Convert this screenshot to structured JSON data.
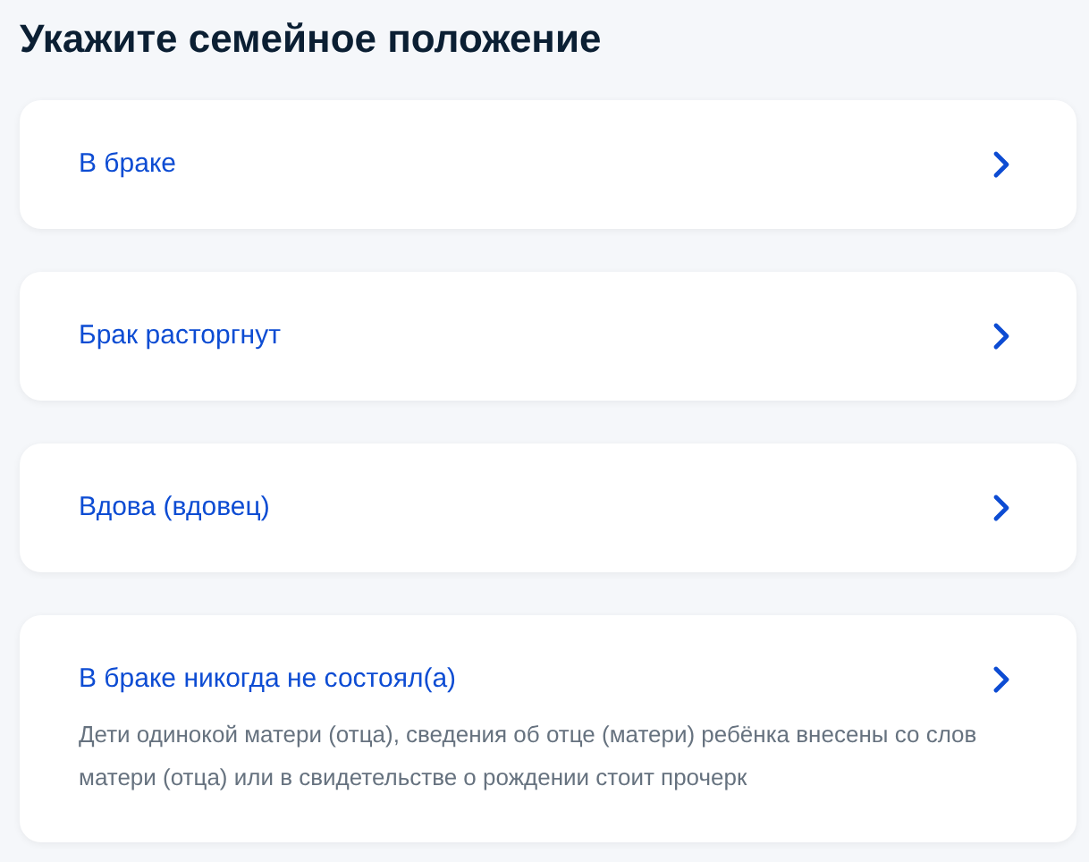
{
  "title": "Укажите семейное положение",
  "options": [
    {
      "label": "В браке"
    },
    {
      "label": "Брак расторгнут"
    },
    {
      "label": "Вдова (вдовец)"
    },
    {
      "label": "В браке никогда не состоял(а)",
      "description": "Дети одинокой матери (отца), сведения об отце (матери) ребёнка внесены со слов матери (отца) или в свидетельстве о рождении стоит прочерк"
    }
  ]
}
